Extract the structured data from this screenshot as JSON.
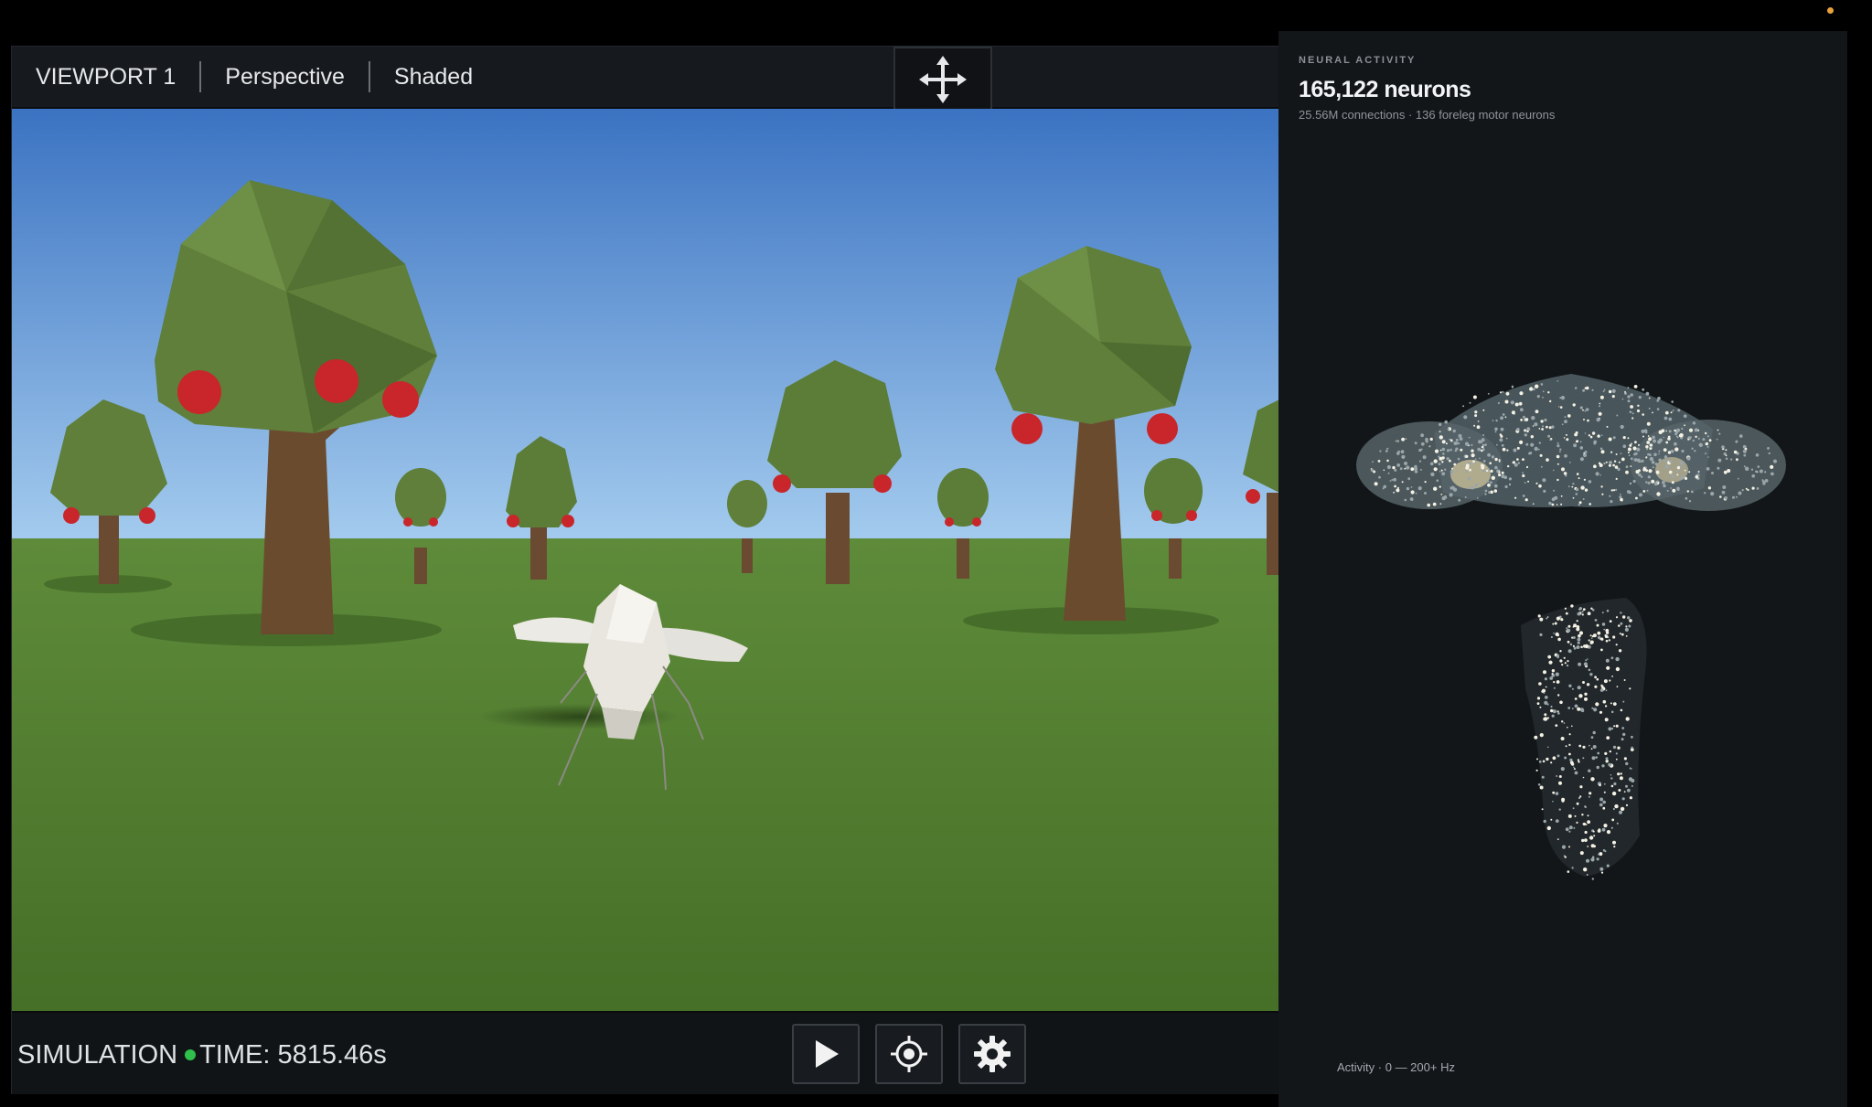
{
  "viewport": {
    "name": "VIEWPORT 1",
    "projection": "Perspective",
    "shading": "Shaded",
    "move_icon": "move-arrows-icon"
  },
  "simulation": {
    "label": "SIMULATION",
    "time_label": "TIME: 5815.46s",
    "status_color": "#2fbf4a"
  },
  "controls": {
    "play_icon": "play-icon",
    "target_icon": "crosshair-icon",
    "settings_icon": "gear-icon"
  },
  "neural_panel": {
    "kicker": "NEURAL ACTIVITY",
    "title": "165,122 neurons",
    "subtitle": "25.56M connections · 136 foreleg motor neurons",
    "legend": "Activity · 0 — 200+ Hz"
  },
  "colors": {
    "sky_top": "#3f77c4",
    "sky_bottom": "#9ec8ef",
    "grass": "#4f7a2e",
    "foliage": "#5f7f3a",
    "apple": "#c8262a",
    "trunk": "#6a4a30",
    "accent_dot": "#e9a23b"
  }
}
